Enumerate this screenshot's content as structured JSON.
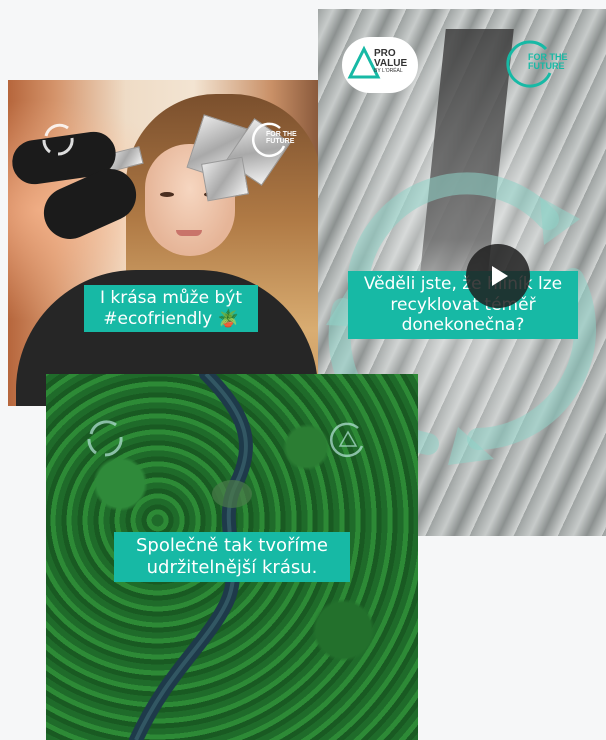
{
  "colors": {
    "accent": "#17b9a5",
    "caption_text": "#ffffff",
    "page_bg": "#f6f7f8"
  },
  "cards": {
    "video": {
      "caption": [
        "Věděli jste, že hliník lze",
        "recyklovat téměř",
        "donekonečna?"
      ],
      "pro_value_logo": {
        "line1": "PRO",
        "line2": "VALUE",
        "line3": "BY L'ORÉAL"
      },
      "for_future_logo": {
        "line1": "FOR THE",
        "line2": "FUTURE"
      },
      "play_icon": "play-icon"
    },
    "model": {
      "caption": [
        "I krása může být",
        "#ecofriendly 🪴"
      ],
      "recycle_icon": "recycle-loop-icon",
      "for_future_logo": {
        "line1": "FOR THE",
        "line2": "FUTURE"
      }
    },
    "forest": {
      "caption": [
        "Společně tak tvoříme",
        "udržitelnější krásu."
      ],
      "recycle_icon": "recycle-loop-icon",
      "pro_value_icon": "pro-value-icon"
    }
  }
}
